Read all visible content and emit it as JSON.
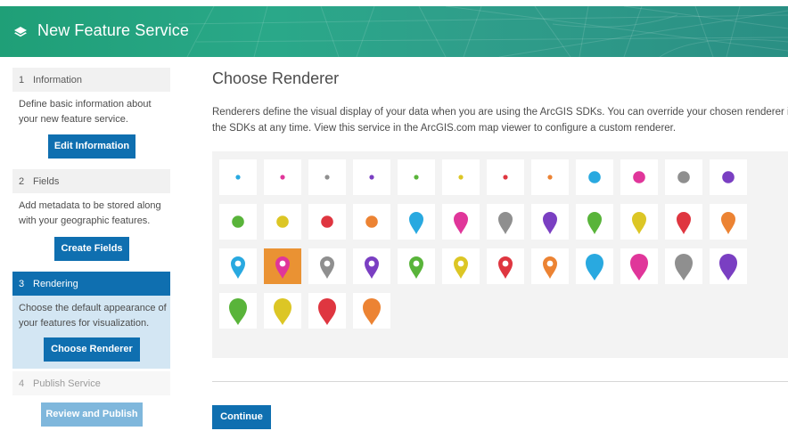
{
  "header": {
    "title": "New Feature Service",
    "logo_icon": "layers-icon"
  },
  "sidebar": {
    "steps": [
      {
        "number": "1",
        "label": "Information",
        "description": "Define basic information about your new feature service.",
        "button": "Edit Information",
        "state": "complete"
      },
      {
        "number": "2",
        "label": "Fields",
        "description": "Add metadata to be stored along with your geographic features.",
        "button": "Create Fields",
        "state": "complete"
      },
      {
        "number": "3",
        "label": "Rendering",
        "description": "Choose the default appearance of your features for visualization.",
        "button": "Choose Renderer",
        "state": "active"
      },
      {
        "number": "4",
        "label": "Publish Service",
        "description": "",
        "button": "Review and Publish",
        "state": "disabled"
      }
    ]
  },
  "main": {
    "title": "Choose Renderer",
    "description_line1": "Renderers define the visual display of your data when you are using the ArcGIS SDKs. You can override your chosen renderer in",
    "description_line2": "the SDKs at any time. View this service in the ArcGIS.com map viewer to configure a custom renderer.",
    "continue_button": "Continue"
  },
  "colors": {
    "header_start": "#1f9f77",
    "accent_blue": "#0f6fb0",
    "active_step_bg": "#d3e6f3",
    "selected_symbol_bg": "#ea9233",
    "palette": [
      "#29a9e0",
      "#e0369a",
      "#8f8f8f",
      "#7a3fc2",
      "#59b43a",
      "#dcc625",
      "#df3640",
      "#ec8333"
    ]
  },
  "symbols": {
    "selected_row": 2,
    "selected_col": 1,
    "rows": [
      [
        "dot-small-blue",
        "dot-small-pink",
        "dot-small-gray",
        "dot-small-purple",
        "dot-small-green",
        "dot-small-yellow",
        "dot-small-red",
        "dot-small-orange",
        "dot-large-blue",
        "dot-large-pink",
        "dot-large-gray",
        "dot-large-purple"
      ],
      [
        "dot-large-green",
        "dot-large-yellow",
        "dot-large-red",
        "dot-large-orange",
        "droplet-blue",
        "droplet-pink",
        "droplet-gray",
        "droplet-purple",
        "droplet-green",
        "droplet-yellow",
        "droplet-red",
        "droplet-orange"
      ],
      [
        "pin-blue",
        "pin-pink",
        "pin-gray",
        "pin-purple",
        "pin-green",
        "pin-yellow",
        "pin-red",
        "pin-orange",
        "droplet-large-blue",
        "droplet-large-pink",
        "droplet-large-gray",
        "droplet-large-purple"
      ],
      [
        "droplet-large-green",
        "droplet-large-yellow",
        "droplet-large-red",
        "droplet-large-orange"
      ]
    ]
  }
}
